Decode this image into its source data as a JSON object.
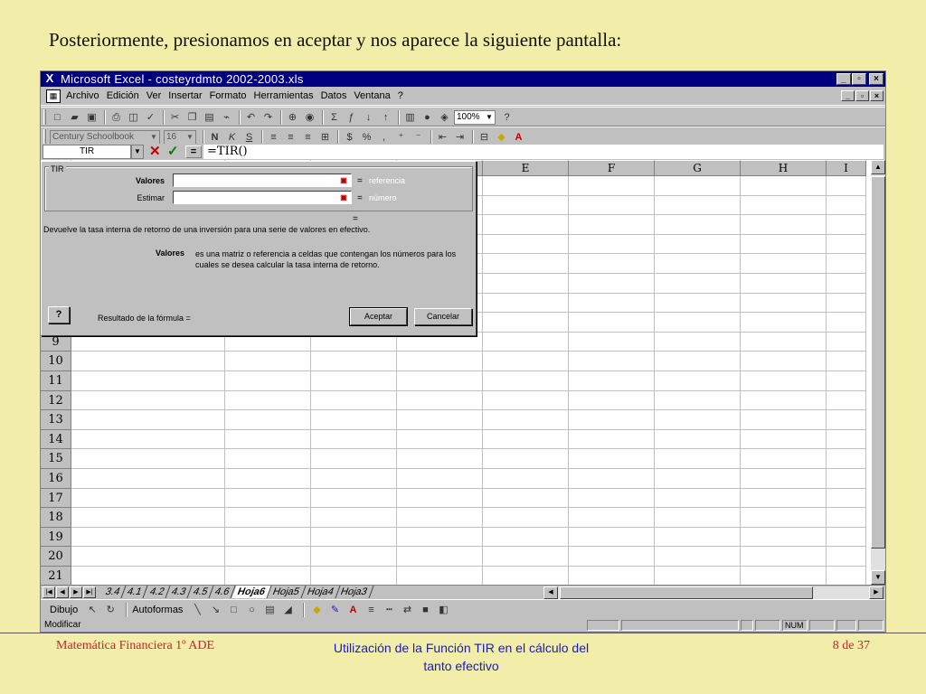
{
  "slide": {
    "heading": "Posteriormente, presionamos en aceptar y nos aparece la siguiente pantalla:",
    "footer_left": "Matemática Financiera 1º ADE",
    "footer_center": "Utilización de la Función TIR en el cálculo del tanto efectivo",
    "footer_right": "8 de 37"
  },
  "window": {
    "title": "Microsoft Excel - costeyrdmto 2002-2003.xls",
    "app_icon": "excel-icon"
  },
  "menu": {
    "items": [
      "Archivo",
      "Edición",
      "Ver",
      "Insertar",
      "Formato",
      "Herramientas",
      "Datos",
      "Ventana",
      "?"
    ]
  },
  "toolbar": {
    "zoom": "100%",
    "font": "Century Schoolbook",
    "font_size": "16"
  },
  "formula_bar": {
    "name_box": "TIR",
    "formula": "=TIR()"
  },
  "grid": {
    "columns": [
      "E",
      "F",
      "G",
      "H",
      "I"
    ],
    "row_numbers": [
      "9",
      "10",
      "11",
      "12",
      "13",
      "14",
      "15",
      "16",
      "17",
      "18",
      "19",
      "20",
      "21"
    ]
  },
  "dialog": {
    "group_title": "TIR",
    "arg1_label": "Valores",
    "arg1_hint": "referencia",
    "arg2_label": "Estimar",
    "arg2_hint": "número",
    "eq": "=",
    "description": "Devuelve la tasa interna de retorno de una inversión para una serie de valores en efectivo.",
    "arg_name": "Valores",
    "arg_description": "es una matriz o referencia a celdas que contengan los números para los cuales se desea calcular la tasa interna de retorno.",
    "help_label": "?",
    "result_label": "Resultado de la fórmula =",
    "ok_label": "Aceptar",
    "cancel_label": "Cancelar"
  },
  "sheets": {
    "tabs": [
      "3.4",
      "4.1",
      "4.2",
      "4.3",
      "4.5",
      "4.6",
      "Hoja6",
      "Hoja5",
      "Hoja4",
      "Hoja3"
    ],
    "active": "Hoja6"
  },
  "drawing": {
    "draw_label": "Dibujo",
    "autoshapes_label": "Autoformas"
  },
  "status": {
    "mode": "Modificar",
    "num": "NUM"
  }
}
